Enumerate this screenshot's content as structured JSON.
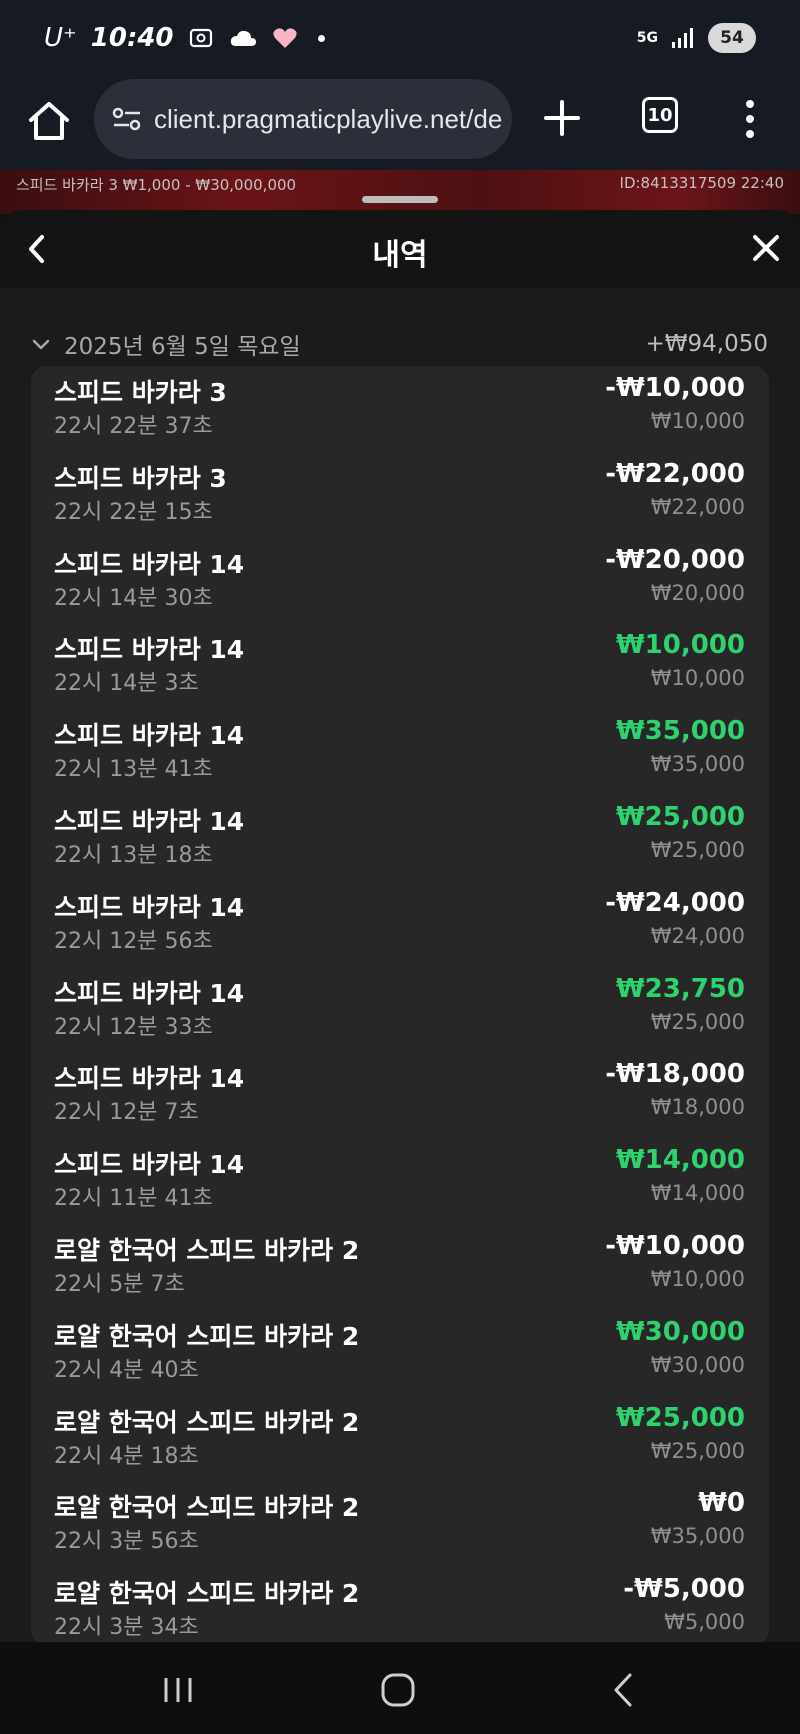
{
  "status_bar": {
    "carrier": "U⁺",
    "time": "10:40",
    "network": "5G",
    "battery": "54"
  },
  "browser": {
    "url": "client.pragmaticplaylive.net/de",
    "tab_count": "10"
  },
  "game_bar": {
    "left_text": "스피드 바카라 3   ₩1,000 - ₩30,000,000",
    "right_text": "ID:8413317509   22:40"
  },
  "sheet": {
    "title": "내역",
    "date_label": "2025년 6월 5일 목요일",
    "date_total": "+₩94,050"
  },
  "transactions": [
    {
      "name": "스피드 바카라 3",
      "time": "22시 22분 37초",
      "amount": "-₩10,000",
      "bet": "₩10,000",
      "type": "loss"
    },
    {
      "name": "스피드 바카라 3",
      "time": "22시 22분 15초",
      "amount": "-₩22,000",
      "bet": "₩22,000",
      "type": "loss"
    },
    {
      "name": "스피드 바카라 14",
      "time": "22시 14분 30초",
      "amount": "-₩20,000",
      "bet": "₩20,000",
      "type": "loss"
    },
    {
      "name": "스피드 바카라 14",
      "time": "22시 14분 3초",
      "amount": "₩10,000",
      "bet": "₩10,000",
      "type": "win"
    },
    {
      "name": "스피드 바카라 14",
      "time": "22시 13분 41초",
      "amount": "₩35,000",
      "bet": "₩35,000",
      "type": "win"
    },
    {
      "name": "스피드 바카라 14",
      "time": "22시 13분 18초",
      "amount": "₩25,000",
      "bet": "₩25,000",
      "type": "win"
    },
    {
      "name": "스피드 바카라 14",
      "time": "22시 12분 56초",
      "amount": "-₩24,000",
      "bet": "₩24,000",
      "type": "loss"
    },
    {
      "name": "스피드 바카라 14",
      "time": "22시 12분 33초",
      "amount": "₩23,750",
      "bet": "₩25,000",
      "type": "win"
    },
    {
      "name": "스피드 바카라 14",
      "time": "22시 12분 7초",
      "amount": "-₩18,000",
      "bet": "₩18,000",
      "type": "loss"
    },
    {
      "name": "스피드 바카라 14",
      "time": "22시 11분 41초",
      "amount": "₩14,000",
      "bet": "₩14,000",
      "type": "win"
    },
    {
      "name": "로얄 한국어 스피드 바카라 2",
      "time": "22시 5분 7초",
      "amount": "-₩10,000",
      "bet": "₩10,000",
      "type": "loss"
    },
    {
      "name": "로얄 한국어 스피드 바카라 2",
      "time": "22시 4분 40초",
      "amount": "₩30,000",
      "bet": "₩30,000",
      "type": "win"
    },
    {
      "name": "로얄 한국어 스피드 바카라 2",
      "time": "22시 4분 18초",
      "amount": "₩25,000",
      "bet": "₩25,000",
      "type": "win"
    },
    {
      "name": "로얄 한국어 스피드 바카라 2",
      "time": "22시 3분 56초",
      "amount": "₩0",
      "bet": "₩35,000",
      "type": "loss"
    },
    {
      "name": "로얄 한국어 스피드 바카라 2",
      "time": "22시 3분 34초",
      "amount": "-₩5,000",
      "bet": "₩5,000",
      "type": "loss"
    }
  ],
  "colors": {
    "win": "#2dd36f",
    "loss": "#ffffff"
  },
  "icons": {
    "home": "home-icon",
    "site_info": "site-settings-icon",
    "new_tab": "plus-icon",
    "menu": "more-vert-icon",
    "back": "chevron-left-icon",
    "close": "close-icon",
    "collapse": "chevron-down-icon"
  }
}
